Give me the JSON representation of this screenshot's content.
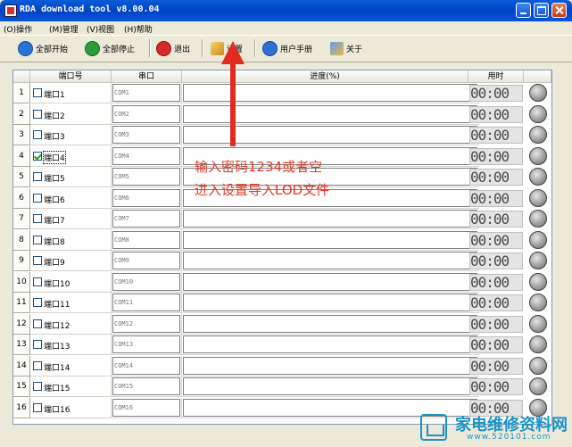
{
  "window": {
    "title": "RDA download tool v8.00.04"
  },
  "menu": [
    "(O)操作",
    "(M)管理",
    "(V)视图",
    "(H)帮助"
  ],
  "toolbar": {
    "start_all": "全部开始",
    "stop_all": "全部停止",
    "exit": "退出",
    "settings": "设置",
    "manual": "用户手册",
    "about": "关于"
  },
  "columns": {
    "port": "端口号",
    "serial": "串口",
    "progress": "进度(%)",
    "time": "用时"
  },
  "rows": [
    {
      "n": "1",
      "port": "端口1",
      "com": "COM1",
      "checked": false
    },
    {
      "n": "2",
      "port": "端口2",
      "com": "COM2",
      "checked": false
    },
    {
      "n": "3",
      "port": "端口3",
      "com": "COM3",
      "checked": false
    },
    {
      "n": "4",
      "port": "端口4",
      "com": "COM4",
      "checked": true
    },
    {
      "n": "5",
      "port": "端口5",
      "com": "COM5",
      "checked": false
    },
    {
      "n": "6",
      "port": "端口6",
      "com": "COM6",
      "checked": false
    },
    {
      "n": "7",
      "port": "端口7",
      "com": "COM7",
      "checked": false
    },
    {
      "n": "8",
      "port": "端口8",
      "com": "COM8",
      "checked": false
    },
    {
      "n": "9",
      "port": "端口9",
      "com": "COM9",
      "checked": false
    },
    {
      "n": "10",
      "port": "端口10",
      "com": "COM10",
      "checked": false
    },
    {
      "n": "11",
      "port": "端口11",
      "com": "COM11",
      "checked": false
    },
    {
      "n": "12",
      "port": "端口12",
      "com": "COM12",
      "checked": false
    },
    {
      "n": "13",
      "port": "端口13",
      "com": "COM13",
      "checked": false
    },
    {
      "n": "14",
      "port": "端口14",
      "com": "COM14",
      "checked": false
    },
    {
      "n": "15",
      "port": "端口15",
      "com": "COM15",
      "checked": false
    },
    {
      "n": "16",
      "port": "端口16",
      "com": "COM16",
      "checked": false
    }
  ],
  "time_display": "00:00",
  "annotation": {
    "line1": "输入密码1234或者空",
    "line2": "进入设置导入LOD文件"
  },
  "watermark": {
    "name": "家电维修资料网",
    "url": "www.520101.com"
  },
  "colors": {
    "title_bar": "#0a55d8",
    "annotation": "#e03c2a",
    "watermark": "#1b93c8"
  }
}
